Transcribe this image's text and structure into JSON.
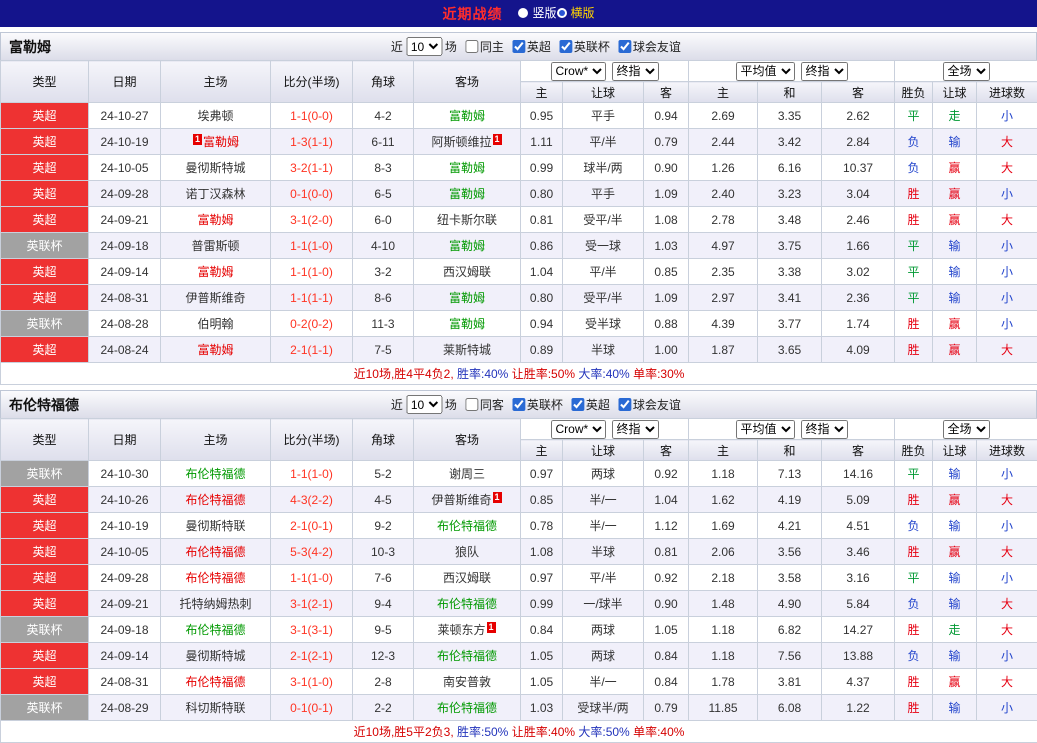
{
  "topbar": {
    "title": "近期战绩",
    "options": [
      {
        "label": "竖版",
        "selected": false,
        "color": "#ffffff"
      },
      {
        "label": "横版",
        "selected": true,
        "color": "#ffd400"
      }
    ]
  },
  "table_header": {
    "left_cols": [
      "类型",
      "日期",
      "主场",
      "比分(半场)",
      "角球",
      "客场"
    ],
    "groups": [
      {
        "selects": [
          "Crow*",
          "终指"
        ],
        "cols": [
          "主",
          "让球",
          "客"
        ]
      },
      {
        "selects": [
          "平均值",
          "终指"
        ],
        "cols": [
          "主",
          "和",
          "客"
        ]
      },
      {
        "selects": [
          "全场"
        ],
        "cols": [
          "胜负",
          "让球",
          "进球数"
        ]
      }
    ]
  },
  "colors": {
    "topbar_bg": "#14148c",
    "title_red": "#ff2d2d",
    "league": {
      "英超": "#ee3232",
      "英联杯": "#a2a2a2"
    },
    "team": {
      "red": "#e60000",
      "green": "#009900",
      "black": "#333333"
    },
    "score": "#ff3322",
    "result": {
      "胜": "#e60012",
      "赢": "#e60012",
      "大": "#e60012",
      "平": "#009933",
      "走": "#009933",
      "负": "#2244cc",
      "输": "#2244cc",
      "小": "#2244cc"
    },
    "summary_red": "#d50000",
    "summary_blue": "#2233bb"
  },
  "sections": [
    {
      "team": "富勒姆",
      "filter": {
        "prefix": "近",
        "games": "10",
        "suffix": "场",
        "checkboxes": [
          {
            "label": "同主",
            "checked": false
          },
          {
            "label": "英超",
            "checked": true
          },
          {
            "label": "英联杯",
            "checked": true
          },
          {
            "label": "球会友谊",
            "checked": true
          }
        ]
      },
      "rows": [
        {
          "league": "英超",
          "date": "24-10-27",
          "home": {
            "name": "埃弗顿",
            "color": "black"
          },
          "score": "1-1(0-0)",
          "corners": "4-2",
          "away": {
            "name": "富勒姆",
            "color": "green"
          },
          "asian": [
            "0.95",
            "平手",
            "0.94"
          ],
          "europe": [
            "2.69",
            "3.35",
            "2.62"
          ],
          "results": [
            "平",
            "走",
            "小"
          ]
        },
        {
          "league": "英超",
          "date": "24-10-19",
          "home": {
            "name": "富勒姆",
            "color": "red",
            "badge": "1",
            "badge_pos": "before"
          },
          "score": "1-3(1-1)",
          "corners": "6-11",
          "away": {
            "name": "阿斯顿维拉",
            "color": "black",
            "badge": "1",
            "badge_pos": "after"
          },
          "asian": [
            "1.11",
            "平/半",
            "0.79"
          ],
          "europe": [
            "2.44",
            "3.42",
            "2.84"
          ],
          "results": [
            "负",
            "输",
            "大"
          ]
        },
        {
          "league": "英超",
          "date": "24-10-05",
          "home": {
            "name": "曼彻斯特城",
            "color": "black"
          },
          "score": "3-2(1-1)",
          "corners": "8-3",
          "away": {
            "name": "富勒姆",
            "color": "green"
          },
          "asian": [
            "0.99",
            "球半/两",
            "0.90"
          ],
          "europe": [
            "1.26",
            "6.16",
            "10.37"
          ],
          "results": [
            "负",
            "赢",
            "大"
          ]
        },
        {
          "league": "英超",
          "date": "24-09-28",
          "home": {
            "name": "诺丁汉森林",
            "color": "black"
          },
          "score": "0-1(0-0)",
          "corners": "6-5",
          "away": {
            "name": "富勒姆",
            "color": "green"
          },
          "asian": [
            "0.80",
            "平手",
            "1.09"
          ],
          "europe": [
            "2.40",
            "3.23",
            "3.04"
          ],
          "results": [
            "胜",
            "赢",
            "小"
          ]
        },
        {
          "league": "英超",
          "date": "24-09-21",
          "home": {
            "name": "富勒姆",
            "color": "red"
          },
          "score": "3-1(2-0)",
          "corners": "6-0",
          "away": {
            "name": "纽卡斯尔联",
            "color": "black"
          },
          "asian": [
            "0.81",
            "受平/半",
            "1.08"
          ],
          "europe": [
            "2.78",
            "3.48",
            "2.46"
          ],
          "results": [
            "胜",
            "赢",
            "大"
          ]
        },
        {
          "league": "英联杯",
          "date": "24-09-18",
          "home": {
            "name": "普雷斯顿",
            "color": "black"
          },
          "score": "1-1(1-0)",
          "corners": "4-10",
          "away": {
            "name": "富勒姆",
            "color": "green"
          },
          "asian": [
            "0.86",
            "受一球",
            "1.03"
          ],
          "europe": [
            "4.97",
            "3.75",
            "1.66"
          ],
          "results": [
            "平",
            "输",
            "小"
          ]
        },
        {
          "league": "英超",
          "date": "24-09-14",
          "home": {
            "name": "富勒姆",
            "color": "red"
          },
          "score": "1-1(1-0)",
          "corners": "3-2",
          "away": {
            "name": "西汉姆联",
            "color": "black"
          },
          "asian": [
            "1.04",
            "平/半",
            "0.85"
          ],
          "europe": [
            "2.35",
            "3.38",
            "3.02"
          ],
          "results": [
            "平",
            "输",
            "小"
          ]
        },
        {
          "league": "英超",
          "date": "24-08-31",
          "home": {
            "name": "伊普斯维奇",
            "color": "black"
          },
          "score": "1-1(1-1)",
          "corners": "8-6",
          "away": {
            "name": "富勒姆",
            "color": "green"
          },
          "asian": [
            "0.80",
            "受平/半",
            "1.09"
          ],
          "europe": [
            "2.97",
            "3.41",
            "2.36"
          ],
          "results": [
            "平",
            "输",
            "小"
          ]
        },
        {
          "league": "英联杯",
          "date": "24-08-28",
          "home": {
            "name": "伯明翰",
            "color": "black"
          },
          "score": "0-2(0-2)",
          "corners": "11-3",
          "away": {
            "name": "富勒姆",
            "color": "green"
          },
          "asian": [
            "0.94",
            "受半球",
            "0.88"
          ],
          "europe": [
            "4.39",
            "3.77",
            "1.74"
          ],
          "results": [
            "胜",
            "赢",
            "小"
          ]
        },
        {
          "league": "英超",
          "date": "24-08-24",
          "home": {
            "name": "富勒姆",
            "color": "red"
          },
          "score": "2-1(1-1)",
          "corners": "7-5",
          "away": {
            "name": "莱斯特城",
            "color": "black"
          },
          "asian": [
            "0.89",
            "半球",
            "1.00"
          ],
          "europe": [
            "1.87",
            "3.65",
            "4.09"
          ],
          "results": [
            "胜",
            "赢",
            "大"
          ]
        }
      ],
      "summary": [
        {
          "text": "近10场,胜4平4负2, ",
          "color": "#d50000"
        },
        {
          "text": "胜率:40% ",
          "color": "#2233bb"
        },
        {
          "text": "让胜率:50% ",
          "color": "#d50000"
        },
        {
          "text": "大率:40% ",
          "color": "#2233bb"
        },
        {
          "text": "单率:30%",
          "color": "#d50000"
        }
      ]
    },
    {
      "team": "布伦特福德",
      "filter": {
        "prefix": "近",
        "games": "10",
        "suffix": "场",
        "checkboxes": [
          {
            "label": "同客",
            "checked": false
          },
          {
            "label": "英联杯",
            "checked": true
          },
          {
            "label": "英超",
            "checked": true
          },
          {
            "label": "球会友谊",
            "checked": true
          }
        ]
      },
      "rows": [
        {
          "league": "英联杯",
          "date": "24-10-30",
          "home": {
            "name": "布伦特福德",
            "color": "green"
          },
          "score": "1-1(1-0)",
          "corners": "5-2",
          "away": {
            "name": "谢周三",
            "color": "black"
          },
          "asian": [
            "0.97",
            "两球",
            "0.92"
          ],
          "europe": [
            "1.18",
            "7.13",
            "14.16"
          ],
          "results": [
            "平",
            "输",
            "小"
          ]
        },
        {
          "league": "英超",
          "date": "24-10-26",
          "home": {
            "name": "布伦特福德",
            "color": "red"
          },
          "score": "4-3(2-2)",
          "corners": "4-5",
          "away": {
            "name": "伊普斯维奇",
            "color": "black",
            "badge": "1",
            "badge_pos": "after"
          },
          "asian": [
            "0.85",
            "半/一",
            "1.04"
          ],
          "europe": [
            "1.62",
            "4.19",
            "5.09"
          ],
          "results": [
            "胜",
            "赢",
            "大"
          ]
        },
        {
          "league": "英超",
          "date": "24-10-19",
          "home": {
            "name": "曼彻斯特联",
            "color": "black"
          },
          "score": "2-1(0-1)",
          "corners": "9-2",
          "away": {
            "name": "布伦特福德",
            "color": "green"
          },
          "asian": [
            "0.78",
            "半/一",
            "1.12"
          ],
          "europe": [
            "1.69",
            "4.21",
            "4.51"
          ],
          "results": [
            "负",
            "输",
            "小"
          ]
        },
        {
          "league": "英超",
          "date": "24-10-05",
          "home": {
            "name": "布伦特福德",
            "color": "red"
          },
          "score": "5-3(4-2)",
          "corners": "10-3",
          "away": {
            "name": "狼队",
            "color": "black"
          },
          "asian": [
            "1.08",
            "半球",
            "0.81"
          ],
          "europe": [
            "2.06",
            "3.56",
            "3.46"
          ],
          "results": [
            "胜",
            "赢",
            "大"
          ]
        },
        {
          "league": "英超",
          "date": "24-09-28",
          "home": {
            "name": "布伦特福德",
            "color": "red"
          },
          "score": "1-1(1-0)",
          "corners": "7-6",
          "away": {
            "name": "西汉姆联",
            "color": "black"
          },
          "asian": [
            "0.97",
            "平/半",
            "0.92"
          ],
          "europe": [
            "2.18",
            "3.58",
            "3.16"
          ],
          "results": [
            "平",
            "输",
            "小"
          ]
        },
        {
          "league": "英超",
          "date": "24-09-21",
          "home": {
            "name": "托特纳姆热刺",
            "color": "black"
          },
          "score": "3-1(2-1)",
          "corners": "9-4",
          "away": {
            "name": "布伦特福德",
            "color": "green"
          },
          "asian": [
            "0.99",
            "一/球半",
            "0.90"
          ],
          "europe": [
            "1.48",
            "4.90",
            "5.84"
          ],
          "results": [
            "负",
            "输",
            "大"
          ]
        },
        {
          "league": "英联杯",
          "date": "24-09-18",
          "home": {
            "name": "布伦特福德",
            "color": "green"
          },
          "score": "3-1(3-1)",
          "corners": "9-5",
          "away": {
            "name": "莱顿东方",
            "color": "black",
            "badge": "1",
            "badge_pos": "after"
          },
          "asian": [
            "0.84",
            "两球",
            "1.05"
          ],
          "europe": [
            "1.18",
            "6.82",
            "14.27"
          ],
          "results": [
            "胜",
            "走",
            "大"
          ]
        },
        {
          "league": "英超",
          "date": "24-09-14",
          "home": {
            "name": "曼彻斯特城",
            "color": "black"
          },
          "score": "2-1(2-1)",
          "corners": "12-3",
          "away": {
            "name": "布伦特福德",
            "color": "green"
          },
          "asian": [
            "1.05",
            "两球",
            "0.84"
          ],
          "europe": [
            "1.18",
            "7.56",
            "13.88"
          ],
          "results": [
            "负",
            "输",
            "小"
          ]
        },
        {
          "league": "英超",
          "date": "24-08-31",
          "home": {
            "name": "布伦特福德",
            "color": "red"
          },
          "score": "3-1(1-0)",
          "corners": "2-8",
          "away": {
            "name": "南安普敦",
            "color": "black"
          },
          "asian": [
            "1.05",
            "半/一",
            "0.84"
          ],
          "europe": [
            "1.78",
            "3.81",
            "4.37"
          ],
          "results": [
            "胜",
            "赢",
            "大"
          ]
        },
        {
          "league": "英联杯",
          "date": "24-08-29",
          "home": {
            "name": "科切斯特联",
            "color": "black"
          },
          "score": "0-1(0-1)",
          "corners": "2-2",
          "away": {
            "name": "布伦特福德",
            "color": "green"
          },
          "asian": [
            "1.03",
            "受球半/两",
            "0.79"
          ],
          "europe": [
            "11.85",
            "6.08",
            "1.22"
          ],
          "results": [
            "胜",
            "输",
            "小"
          ]
        }
      ],
      "summary": [
        {
          "text": "近10场,胜5平2负3, ",
          "color": "#d50000"
        },
        {
          "text": "胜率:50% ",
          "color": "#2233bb"
        },
        {
          "text": "让胜率:40% ",
          "color": "#d50000"
        },
        {
          "text": "大率:50% ",
          "color": "#2233bb"
        },
        {
          "text": "单率:40%",
          "color": "#d50000"
        }
      ]
    }
  ]
}
